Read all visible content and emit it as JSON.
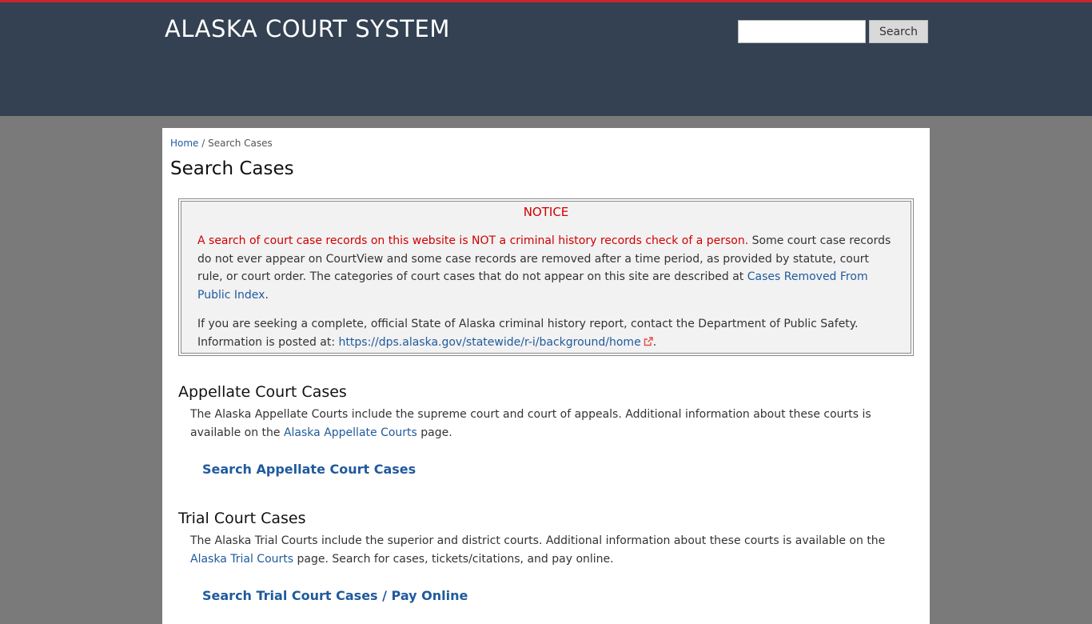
{
  "header": {
    "site_title": "ALASKA COURT SYSTEM",
    "search_placeholder": "",
    "search_button": "Search"
  },
  "breadcrumb": {
    "home": "Home",
    "separator": " / ",
    "current": "Search Cases"
  },
  "page_title": "Search Cases",
  "notice": {
    "title": "NOTICE",
    "warning": "A search of court case records on this website is NOT a criminal history records check of a person.",
    "body1": " Some court case records do not ever appear on CourtView and some case records are removed after a time period, as provided by statute, court rule, or court order. The categories of court cases that do not appear on this site are described at ",
    "removed_link": "Cases Removed From Public Index",
    "period1": ".",
    "body2": "If you are seeking a complete, official State of Alaska criminal history report, contact the Department of Public Safety. Information is posted at: ",
    "dps_link": "https://dps.alaska.gov/statewide/r-i/background/home",
    "period2": "."
  },
  "appellate": {
    "heading": "Appellate Court Cases",
    "text1": "The Alaska Appellate Courts include the supreme court and court of appeals. Additional information about these courts is available on the ",
    "link": "Alaska Appellate Courts",
    "text2": " page.",
    "search_link": "Search Appellate Court Cases"
  },
  "trial": {
    "heading": "Trial Court Cases",
    "text1": "The Alaska Trial Courts include the superior and district courts. Additional information about these courts is available on the ",
    "link": "Alaska Trial Courts",
    "text2": " page. Search for cases, tickets/citations, and pay online.",
    "search_link": "Search Trial Court Cases / Pay Online"
  },
  "colors": {
    "header_bg": "#334152",
    "top_accent": "#c8262c",
    "page_bg": "#7a7a7a",
    "link": "#1f5a9c",
    "notice_red": "#d00000"
  }
}
